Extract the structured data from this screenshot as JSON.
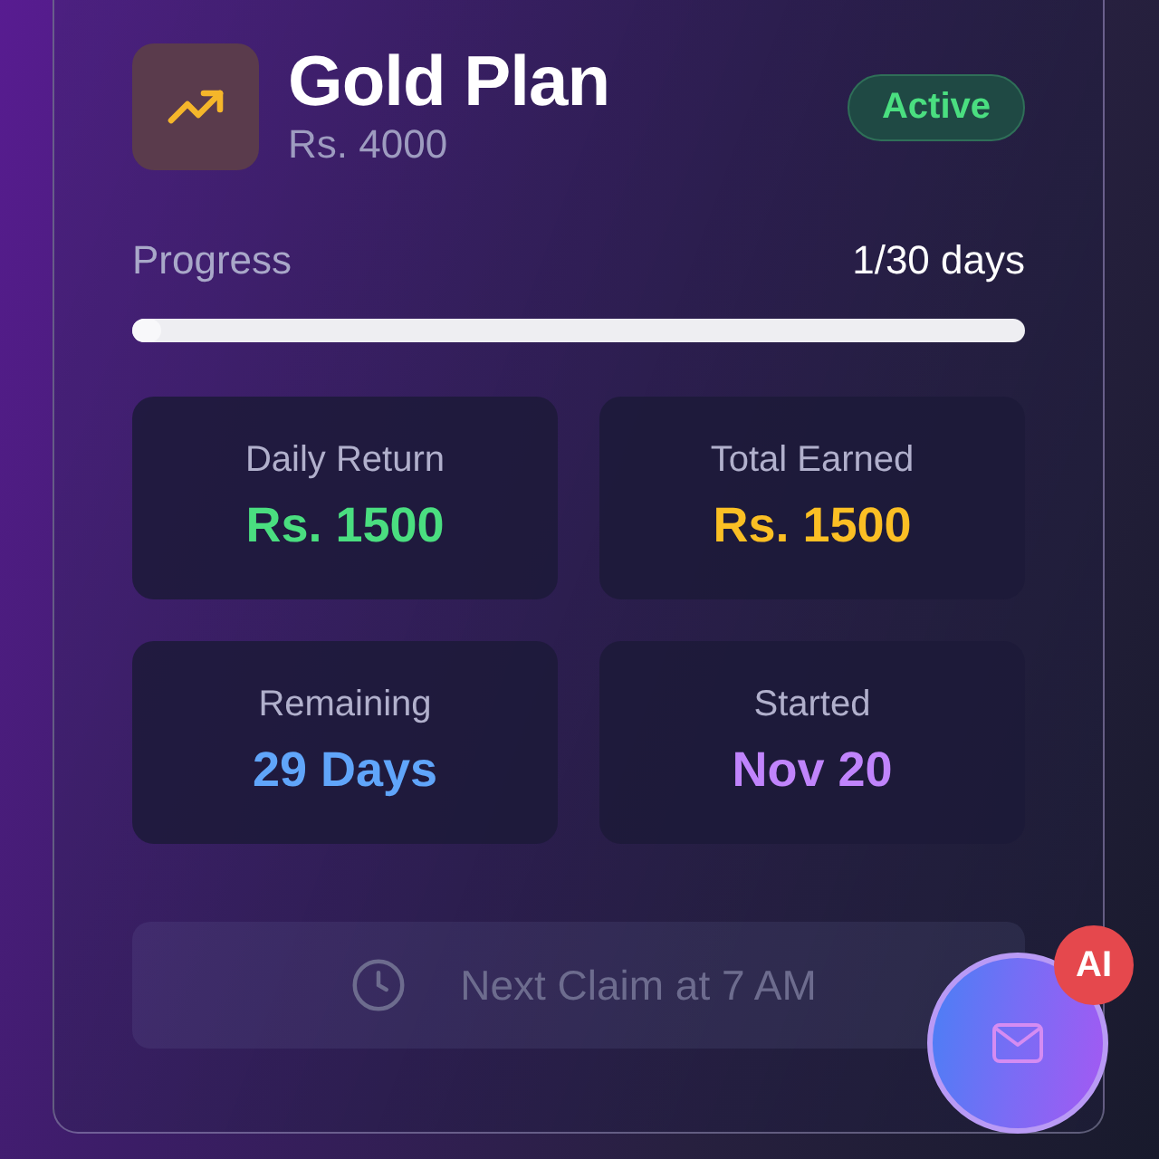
{
  "plan": {
    "name": "Gold Plan",
    "amount": "Rs. 4000",
    "status": {
      "label": "Active",
      "kind": "active"
    }
  },
  "progress": {
    "label": "Progress",
    "reading": "1/30 days",
    "level": 0.033
  },
  "stats": [
    {
      "label": "Daily Return",
      "value": "Rs. 1500",
      "color": "#4ade80"
    },
    {
      "label": "Total Earned",
      "value": "Rs. 1500",
      "color": "#fbbf24"
    },
    {
      "label": "Remaining",
      "value": "29 Days",
      "color": "#60a5fa"
    },
    {
      "label": "Started",
      "value": "Nov 20",
      "color": "#c084fc"
    }
  ],
  "claim_button": {
    "label": "Next Claim at 7 AM",
    "disabled": true
  },
  "chat_button": {
    "badge": "AI"
  }
}
